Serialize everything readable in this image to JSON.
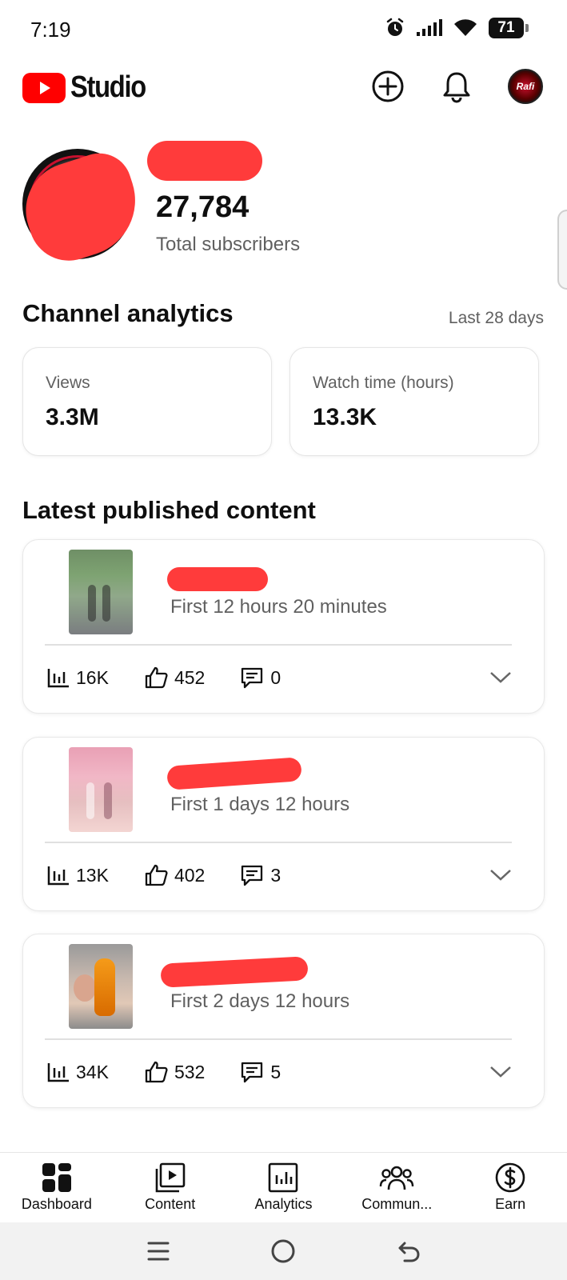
{
  "status_bar": {
    "time": "7:19",
    "battery": "71"
  },
  "app_bar": {
    "brand": "Studio",
    "avatar_text": "Rafi"
  },
  "channel": {
    "subscriber_count": "27,784",
    "subscriber_label": "Total subscribers"
  },
  "analytics": {
    "title": "Channel analytics",
    "range": "Last 28 days",
    "stats": [
      {
        "label": "Views",
        "value": "3.3M"
      },
      {
        "label": "Watch time (hours)",
        "value": "13.3K"
      }
    ]
  },
  "latest": {
    "title": "Latest published content",
    "items": [
      {
        "meta": "First 12 hours 20 minutes",
        "views": "16K",
        "likes": "452",
        "comments": "0"
      },
      {
        "meta": "First 1 days 12 hours",
        "views": "13K",
        "likes": "402",
        "comments": "3"
      },
      {
        "meta": "First 2 days 12 hours",
        "views": "34K",
        "likes": "532",
        "comments": "5"
      }
    ]
  },
  "bottom_nav": {
    "items": [
      {
        "label": "Dashboard",
        "icon": "dashboard-icon"
      },
      {
        "label": "Content",
        "icon": "content-icon"
      },
      {
        "label": "Analytics",
        "icon": "analytics-icon"
      },
      {
        "label": "Commun...",
        "icon": "community-icon"
      },
      {
        "label": "Earn",
        "icon": "earn-icon"
      }
    ]
  },
  "colors": {
    "brand_red": "#ff0000",
    "redaction": "#ff3b3b",
    "secondary_text": "#606060"
  }
}
